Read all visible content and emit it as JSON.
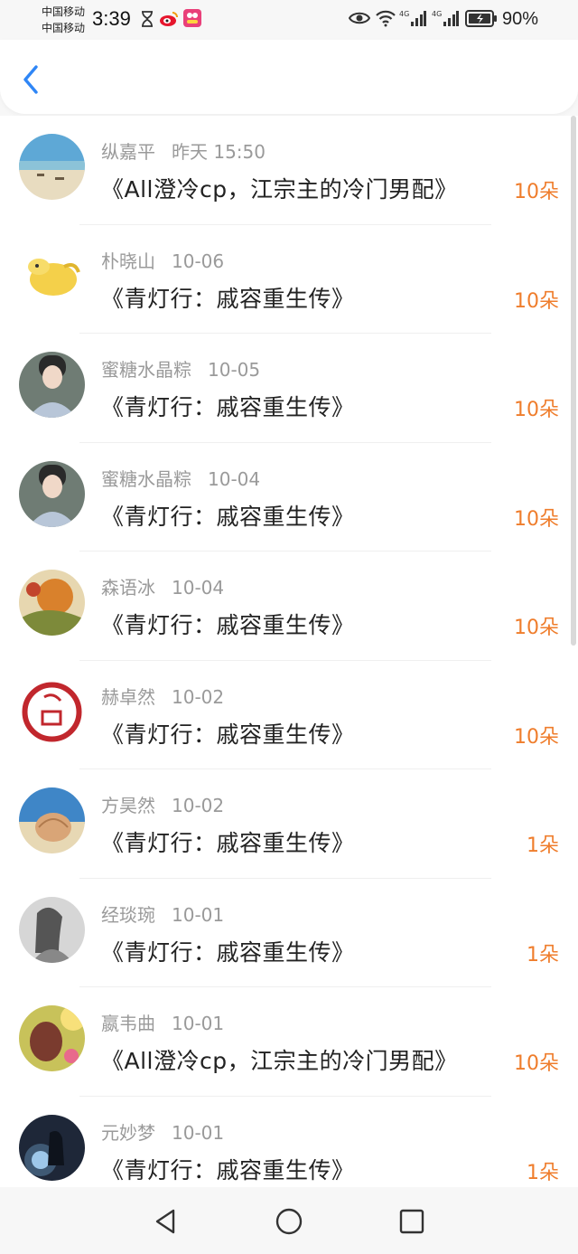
{
  "status_bar": {
    "carrier_1": "中国移动",
    "carrier_2": "中国移动",
    "time": "3:39",
    "battery": "90%",
    "icons": [
      "hourglass-icon",
      "weibo-icon",
      "app-icon",
      "eye-icon",
      "wifi-icon",
      "signal-4g-icon",
      "signal-4g-icon",
      "battery-icon"
    ]
  },
  "header": {
    "back_icon": "chevron-left-icon"
  },
  "colors": {
    "accent": "#2f86f6",
    "amount": "#ef7d2c",
    "meta": "#9a9a9a"
  },
  "items": [
    {
      "name": "纵嘉平",
      "date": "昨天 15:50",
      "title": "《All澄冷cp，江宗主的冷门男配》",
      "amount": "10朵"
    },
    {
      "name": "朴晓山",
      "date": "10-06",
      "title": "《青灯行：戚容重生传》",
      "amount": "10朵"
    },
    {
      "name": "蜜糖水晶粽",
      "date": "10-05",
      "title": "《青灯行：戚容重生传》",
      "amount": "10朵"
    },
    {
      "name": "蜜糖水晶粽",
      "date": "10-04",
      "title": "《青灯行：戚容重生传》",
      "amount": "10朵"
    },
    {
      "name": "森语冰",
      "date": "10-04",
      "title": "《青灯行：戚容重生传》",
      "amount": "10朵"
    },
    {
      "name": "赫卓然",
      "date": "10-02",
      "title": "《青灯行：戚容重生传》",
      "amount": "10朵"
    },
    {
      "name": "方昊然",
      "date": "10-02",
      "title": "《青灯行：戚容重生传》",
      "amount": "1朵"
    },
    {
      "name": "经琰琬",
      "date": "10-01",
      "title": "《青灯行：戚容重生传》",
      "amount": "1朵"
    },
    {
      "name": "嬴韦曲",
      "date": "10-01",
      "title": "《All澄冷cp，江宗主的冷门男配》",
      "amount": "10朵"
    },
    {
      "name": "元妙梦",
      "date": "10-01",
      "title": "《青灯行：戚容重生传》",
      "amount": "1朵"
    }
  ],
  "nav_bar": {
    "icons": [
      "back-triangle-icon",
      "home-circle-icon",
      "recents-square-icon"
    ]
  }
}
